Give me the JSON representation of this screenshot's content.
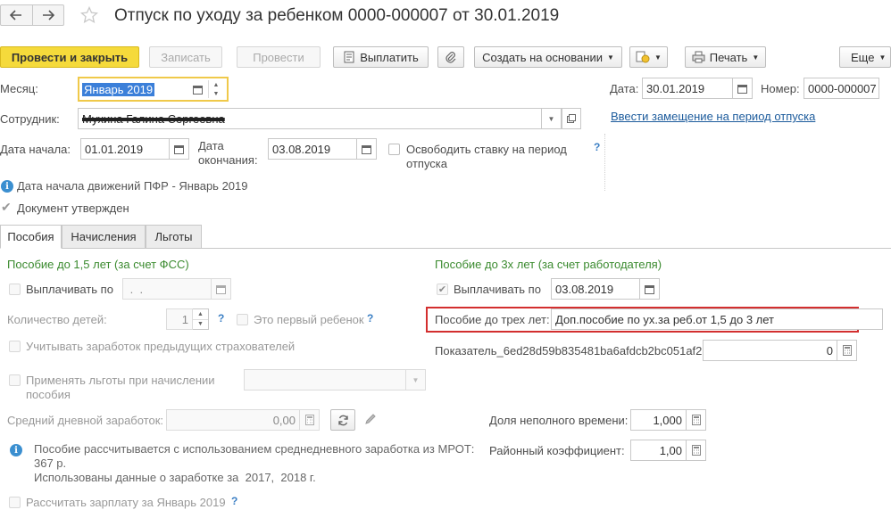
{
  "header": {
    "title": "Отпуск по уходу за ребенком 0000-000007 от 30.01.2019",
    "back_icon": "arrow-left-icon",
    "forward_icon": "arrow-right-icon",
    "favorite_icon": "star-icon"
  },
  "toolbar": {
    "post_close": "Провести и закрыть",
    "save": "Записать",
    "post": "Провести",
    "pay": "Выплатить",
    "create_based_on": "Создать на основании",
    "print": "Печать",
    "more": "Еще"
  },
  "form": {
    "month_label": "Месяц:",
    "month_value": "Январь 2019",
    "date_label": "Дата:",
    "date_value": "30.01.2019",
    "number_label": "Номер:",
    "number_value": "0000-000007",
    "employee_label": "Сотрудник:",
    "employee_value": "Мухина Галина Сергеевна",
    "replacement_link": "Ввести замещение на период отпуска",
    "start_label": "Дата начала:",
    "start_value": "01.01.2019",
    "end_label_1": "Дата",
    "end_label_2": "окончания:",
    "end_value": "03.08.2019",
    "release_rate_1": "Освободить ставку на период",
    "release_rate_2": "отпуска",
    "pfr_info": "Дата начала движений ПФР - Январь 2019",
    "approved_label": "Документ утвержден"
  },
  "tabs": [
    "Пособия",
    "Начисления",
    "Льготы"
  ],
  "left": {
    "section_title": "Пособие до 1,5 лет (за счет ФСС)",
    "pay_until_label": "Выплачивать по",
    "pay_until_value": " .  .",
    "children_label": "Количество детей:",
    "children_value": "1",
    "first_child_label": "Это первый ребенок",
    "prev_insurers_label": "Учитывать заработок предыдущих страхователей",
    "apply_benefits_1": "Применять льготы при начислении",
    "apply_benefits_2": "пособия",
    "avg_daily_label": "Средний дневной заработок:",
    "avg_daily_value": "0,00",
    "info_1": "Пособие рассчитывается с использованием среднедневного заработка из МРОТ:",
    "info_2": "367 р.",
    "info_3": "Использованы данные о заработке за  2017,  2018 г.",
    "calc_salary_label": "Рассчитать зарплату за Январь 2019"
  },
  "right": {
    "section_title": "Пособие до 3х лет (за счет работодателя)",
    "pay_until_label": "Выплачивать по",
    "pay_until_value": "03.08.2019",
    "allowance_label": "Пособие до трех лет:",
    "allowance_value": "Доп.пособие по ух.за реб.от 1,5 до 3 лет",
    "indicator_label": "Показатель_6ed28d59b835481ba6afdcb2bc051af2:",
    "indicator_value": "0",
    "part_time_label": "Доля неполного времени:",
    "part_time_value": "1,000",
    "regional_label": "Районный коэффициент:",
    "regional_value": "1,00"
  },
  "colors": {
    "primary_button": "#f5da3b",
    "section_title": "#3a8a2e",
    "highlight_box": "#d32f2f",
    "link": "#1c5b9c"
  }
}
